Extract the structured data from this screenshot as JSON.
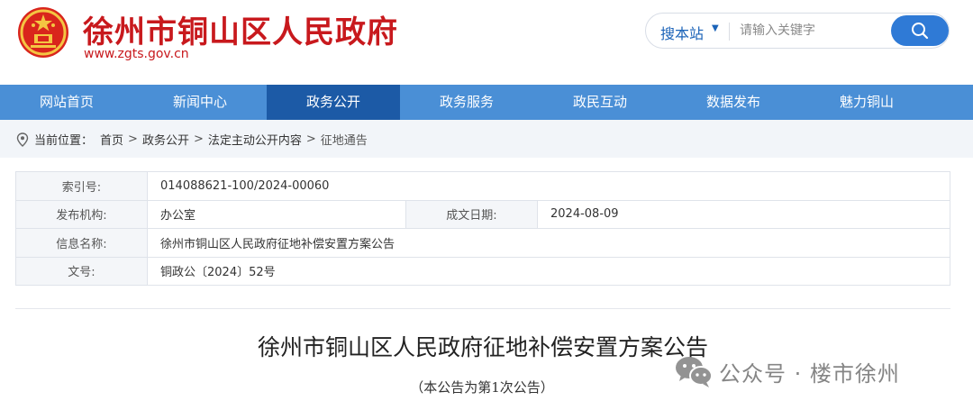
{
  "header": {
    "site_title": "徐州市铜山区人民政府",
    "site_url": "www.zgts.gov.cn",
    "brand_color": "#c8191d",
    "search": {
      "scope_label": "搜本站",
      "placeholder": "请输入关键字"
    }
  },
  "nav": {
    "items": [
      {
        "label": "网站首页"
      },
      {
        "label": "新闻中心"
      },
      {
        "label": "政务公开"
      },
      {
        "label": "政务服务"
      },
      {
        "label": "政民互动"
      },
      {
        "label": "数据发布"
      },
      {
        "label": "魅力铜山"
      }
    ],
    "active_index": 2,
    "bar_color": "#4a8fd6",
    "active_color": "#1c5aa6"
  },
  "breadcrumb": {
    "prefix": "当前位置：",
    "items": [
      "首页",
      "政务公开",
      "法定主动公开内容",
      "征地通告"
    ],
    "sep": ">"
  },
  "info": {
    "index_label": "索引号:",
    "index_value": "014088621-100/2024-00060",
    "publisher_label": "发布机构:",
    "publisher_value": "办公室",
    "date_label": "成文日期:",
    "date_value": "2024-08-09",
    "name_label": "信息名称:",
    "name_value": "徐州市铜山区人民政府征地补偿安置方案公告",
    "docno_label": "文号:",
    "docno_value": "铜政公〔2024〕52号"
  },
  "article": {
    "title": "徐州市铜山区人民政府征地补偿安置方案公告",
    "subtitle": "（本公告为第1次公告）"
  },
  "watermark": {
    "text": "公众号 · 楼市徐州",
    "icon": "wechat-icon"
  }
}
